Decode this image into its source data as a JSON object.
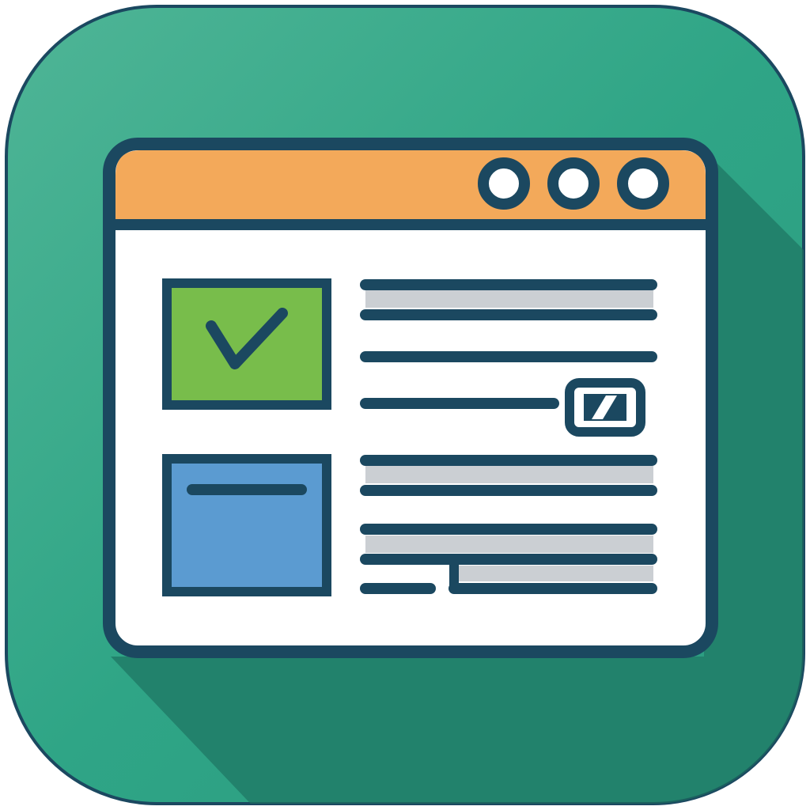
{
  "icon": {
    "subject": "browser-window-form",
    "colors": {
      "tile_light": "#4FB596",
      "tile_mid": "#2FA586",
      "tile_dark": "#1E7F6A",
      "shadow": "#1D6F5E",
      "outline": "#1B4860",
      "titlebar": "#F3A95A",
      "window_bg": "#FFFFFF",
      "check_box_fill": "#78BD4B",
      "blue_box_fill": "#5B9BD1",
      "highlight_band": "#CBCFD3",
      "control_dot_fill": "#FFFFFF"
    },
    "window_controls": [
      "dot",
      "dot",
      "dot"
    ],
    "check_box": {
      "state": "checked",
      "icon": "check-icon"
    },
    "edit_badge": {
      "icon": "pencil-edit-icon"
    },
    "blue_box": {
      "icon": "text-line-icon"
    }
  }
}
